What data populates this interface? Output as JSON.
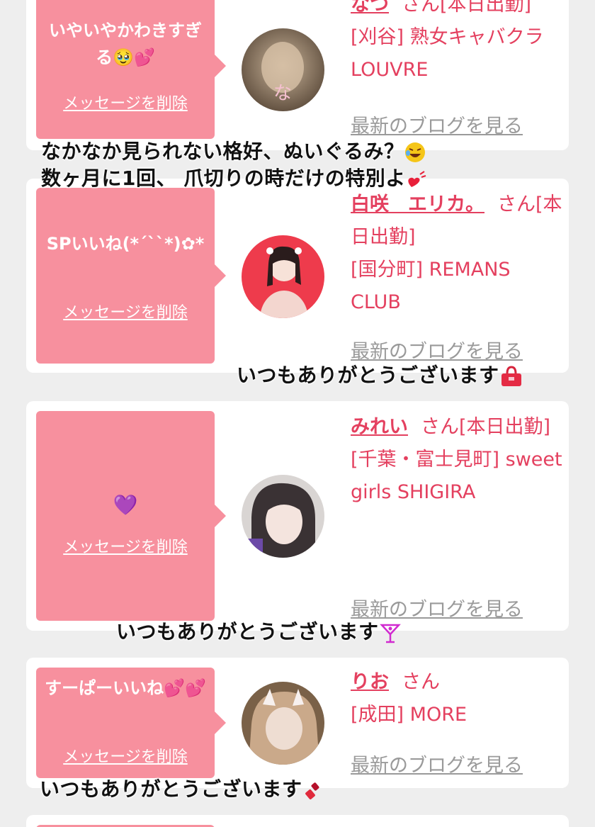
{
  "cards": [
    {
      "message": "いやいやかわきすぎる🥹💕",
      "delete_label": "メッセージを削除",
      "name": "なつ",
      "suffix": "さん[本日出勤]",
      "shop": "[刈谷] 熟女キャバクラ LOUVRE",
      "blog_label": "最新のブログを見る"
    },
    {
      "message": "SPいいね(*´``*)✿*",
      "delete_label": "メッセージを削除",
      "name": "白咲　エリカ。",
      "suffix": "さん[本日出勤]",
      "shop": "[国分町] REMANS CLUB",
      "blog_label": "最新のブログを見る"
    },
    {
      "message": "💜",
      "delete_label": "メッセージを削除",
      "name": "みれい",
      "suffix": "さん[本日出勤]",
      "shop": "[千葉・富士見町] sweet girls SHIGIRA",
      "blog_label": "最新のブログを見る"
    },
    {
      "message": "すーぱーいいね💕💕",
      "delete_label": "メッセージを削除",
      "name": "りお",
      "suffix": "さん",
      "shop": "[成田] MORE",
      "blog_label": "最新のブログを見る"
    }
  ],
  "overlays": {
    "line1": "なかなか見られない格好、ぬいぐるみ？",
    "line2": "数ヶ月に1回、 爪切りの時だけの特別よ",
    "thanks1": "いつもありがとうございます",
    "thanks2": "いつもありがとうございます",
    "thanks3": "いつもありがとうございます"
  },
  "colors": {
    "page_bg": "#eeeeee",
    "card_bg": "#ffffff",
    "bubble": "#f7909e",
    "accent_text": "#e4405f",
    "link_gray": "#9a9a9a"
  }
}
